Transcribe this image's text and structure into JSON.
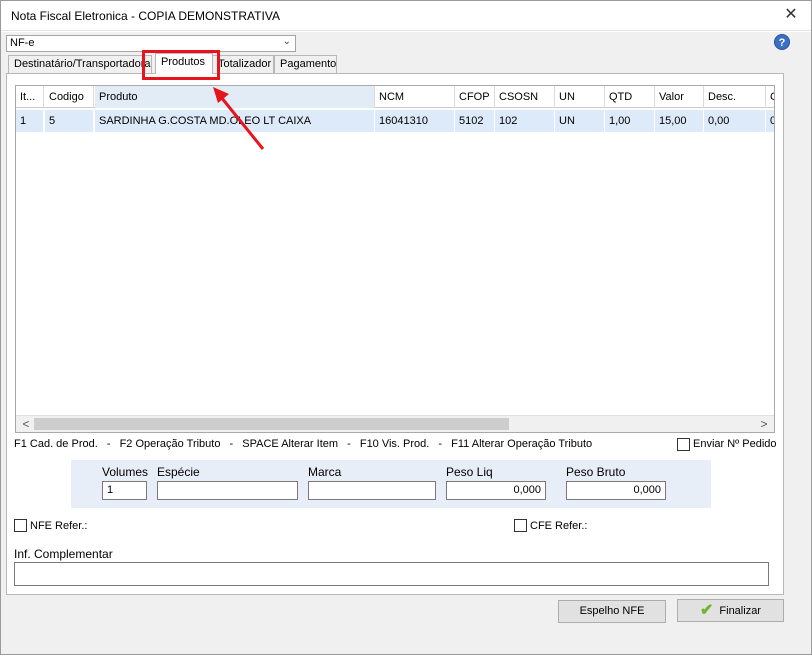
{
  "window": {
    "title": "Nota Fiscal Eletronica - COPIA DEMONSTRATIVA",
    "close_glyph": "✕"
  },
  "doc_type": {
    "selected": "NF-e"
  },
  "help_glyph": "?",
  "tabs": [
    {
      "label": "Destinatário/Transportadora",
      "active": false
    },
    {
      "label": "Produtos",
      "active": true
    },
    {
      "label": "Totalizador",
      "active": false
    },
    {
      "label": "Pagamento",
      "active": false
    }
  ],
  "grid": {
    "columns": [
      "It...",
      "Codigo",
      "Produto",
      "NCM",
      "CFOP",
      "CSOSN",
      "UN",
      "QTD",
      "Valor",
      "Desc.",
      "C"
    ],
    "rows": [
      [
        "1",
        "5",
        "SARDINHA G.COSTA MD.OLEO LT CAIXA",
        "16041310",
        "5102",
        "102",
        "UN",
        "1,00",
        "15,00",
        "0,00",
        "0,"
      ]
    ],
    "scroll_left": "<",
    "scroll_right": ">"
  },
  "shortcuts": [
    "F1 Cad. de Prod.",
    "-",
    "F2 Operação Tributo",
    "-",
    "SPACE Alterar Item",
    "-",
    "F10 Vis. Prod.",
    "-",
    "F11 Alterar Operação Tributo"
  ],
  "enviar_pedido": {
    "label": "Enviar Nº Pedido",
    "checked": false
  },
  "volumes": {
    "volumes_label": "Volumes",
    "volumes_value": "1",
    "especie_label": "Espécie",
    "especie_value": "",
    "marca_label": "Marca",
    "marca_value": "",
    "peso_liq_label": "Peso Liq",
    "peso_liq_value": "0,000",
    "peso_bruto_label": "Peso Bruto",
    "peso_bruto_value": "0,000"
  },
  "nfe_refer": {
    "label": "NFE Refer.:",
    "checked": false
  },
  "cfe_refer": {
    "label": "CFE Refer.:",
    "checked": false
  },
  "inf_complementar": {
    "label": "Inf. Complementar",
    "value": ""
  },
  "buttons": {
    "espelho": "Espelho NFE",
    "finalizar": "Finalizar"
  },
  "colors": {
    "highlight": "#e8141c",
    "selection": "#ddeafa"
  }
}
